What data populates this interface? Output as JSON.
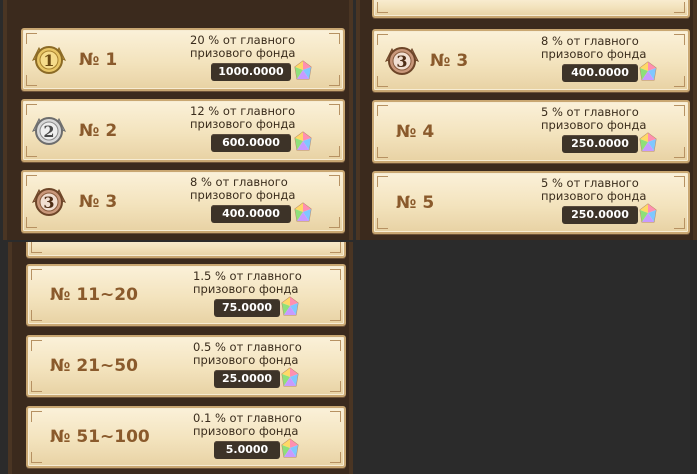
{
  "panels": [
    {
      "rows": [
        {
          "rank": "№ 1",
          "desc_line1": "20 % от главного",
          "desc_line2": "призового фонда",
          "amount": "1000.0000",
          "medal": "gold-medal-1"
        },
        {
          "rank": "№ 2",
          "desc_line1": "12 % от главного",
          "desc_line2": "призового фонда",
          "amount": "600.0000",
          "medal": "silver-medal-2"
        },
        {
          "rank": "№ 3",
          "desc_line1": "8 % от главного",
          "desc_line2": "призового фонда",
          "amount": "400.0000",
          "medal": "bronze-medal-3"
        }
      ]
    },
    {
      "rows": [
        {
          "rank": "№ 3",
          "desc_line1": "8 % от главного",
          "desc_line2": "призового фонда",
          "amount": "400.0000",
          "medal": "bronze-medal-3"
        },
        {
          "rank": "№ 4",
          "desc_line1": "5 % от главного",
          "desc_line2": "призового фонда",
          "amount": "250.0000"
        },
        {
          "rank": "№ 5",
          "desc_line1": "5 % от главного",
          "desc_line2": "призового фонда",
          "amount": "250.0000"
        }
      ]
    },
    {
      "rows": [
        {
          "rank": "№ 11~20",
          "desc_line1": "1.5 % от главного",
          "desc_line2": "призового фонда",
          "amount": "75.0000"
        },
        {
          "rank": "№ 21~50",
          "desc_line1": "0.5 % от главного",
          "desc_line2": "призового фонда",
          "amount": "25.0000"
        },
        {
          "rank": "№ 51~100",
          "desc_line1": "0.1 % от главного",
          "desc_line2": "призового фонда",
          "amount": "5.0000"
        }
      ]
    }
  ],
  "icons": {
    "currency": "rainbow-gem-icon"
  },
  "colors": {
    "rank_text": "#8a5a2c",
    "row_bg": "#f3e3bd",
    "amount_bg": "#3d3328",
    "panel_bg": "#3b2a1d"
  }
}
